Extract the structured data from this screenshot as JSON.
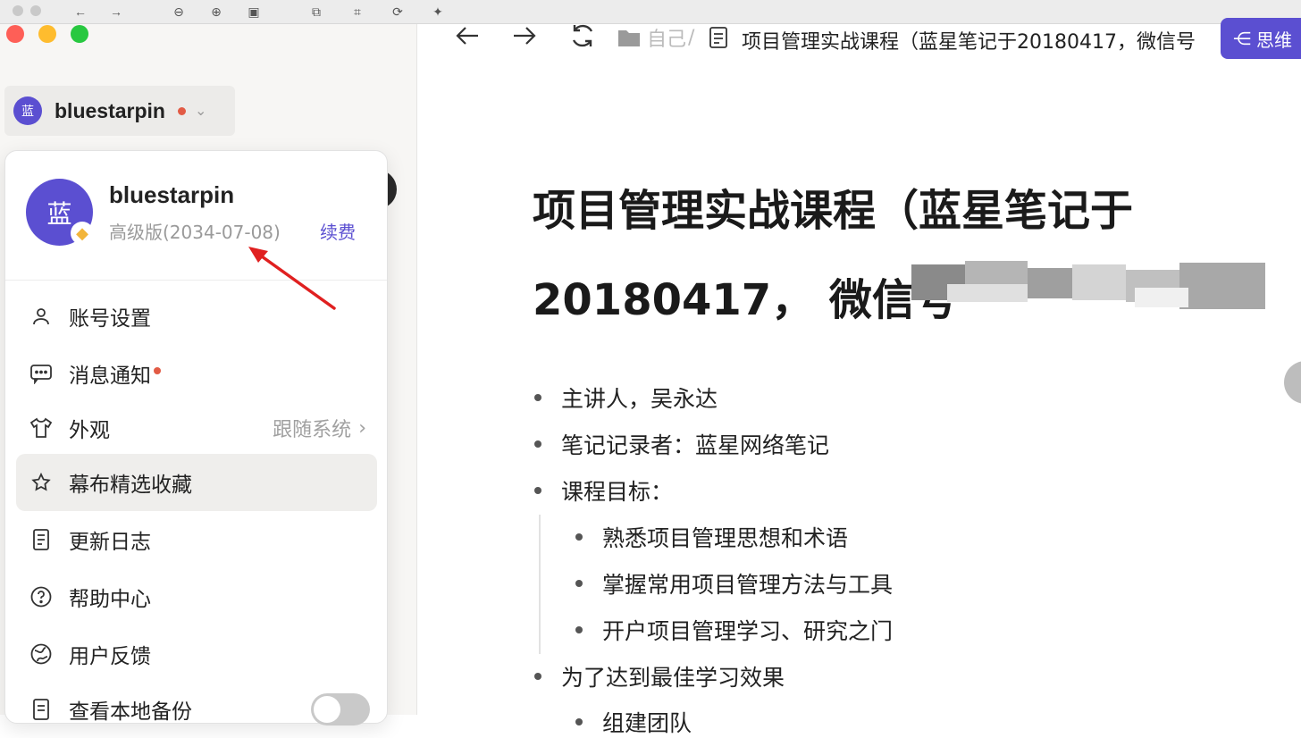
{
  "sidebar": {
    "user_chip": {
      "avatar_char": "蓝",
      "name": "bluestarpin"
    },
    "popup": {
      "avatar_char": "蓝",
      "name": "bluestarpin",
      "plan": "高级版(2034-07-08)",
      "renew_label": "续费",
      "menu": [
        {
          "label": "账号设置",
          "icon": "user-icon"
        },
        {
          "label": "消息通知",
          "icon": "message-icon"
        },
        {
          "label": "外观",
          "icon": "shirt-icon",
          "right": "跟随系统"
        },
        {
          "label": "幕布精选收藏",
          "icon": "star-icon"
        },
        {
          "label": "更新日志",
          "icon": "document-icon"
        },
        {
          "label": "帮助中心",
          "icon": "help-icon"
        },
        {
          "label": "用户反馈",
          "icon": "feedback-icon"
        },
        {
          "label": "查看本地备份",
          "icon": "backup-icon"
        }
      ]
    }
  },
  "main": {
    "breadcrumb": {
      "folder_label": "自己",
      "doc_title": "项目管理实战课程（蓝星笔记于20180417，微信号"
    },
    "mindmap_label": "思维",
    "doc": {
      "title_line1": "项目管理实战课程（蓝星笔记于",
      "title_line2": "20180417，  微信号",
      "bullets": [
        {
          "text": "主讲人，吴永达",
          "level": 1
        },
        {
          "text": "笔记记录者：蓝星网络笔记",
          "level": 1
        },
        {
          "text": "课程目标：",
          "level": 1
        },
        {
          "text": "熟悉项目管理思想和术语",
          "level": 2
        },
        {
          "text": "掌握常用项目管理方法与工具",
          "level": 2
        },
        {
          "text": "开户项目管理学习、研究之门",
          "level": 2
        },
        {
          "text": "为了达到最佳学习效果",
          "level": 1
        },
        {
          "text": "组建团队",
          "level": 2
        }
      ]
    }
  },
  "colors": {
    "accent": "#5b4fd1",
    "dot": "#e25b45"
  }
}
